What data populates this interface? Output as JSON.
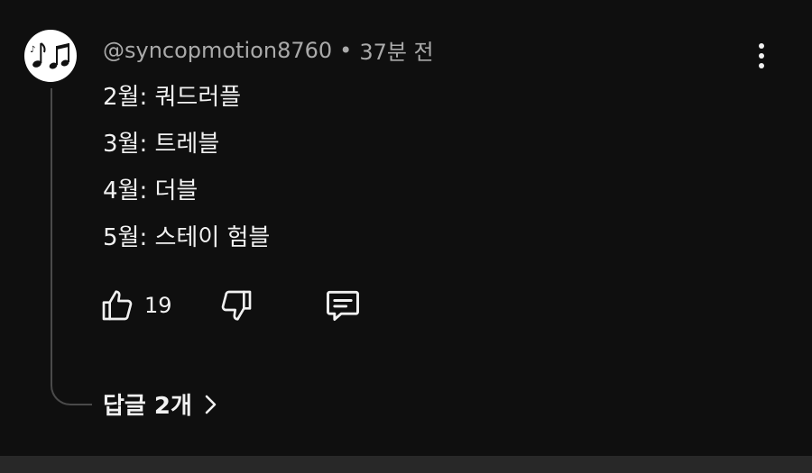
{
  "comment": {
    "author": "@syncopmotion8760",
    "separator": "•",
    "time": "37분 전",
    "lines": [
      "2월: 쿼드러플",
      "3월: 트레블",
      "4월: 더블",
      "5월: 스테이 험블"
    ],
    "likes": "19",
    "replies_label": "답글 2개"
  },
  "icons": {
    "avatar": "music-notes-icon",
    "menu": "more-vert-icon",
    "like": "thumbs-up-icon",
    "dislike": "thumbs-down-icon",
    "reply": "comment-icon",
    "expand": "chevron-right-icon"
  },
  "colors": {
    "background": "#0f0f0f",
    "text": "#f1f1f1",
    "secondary_text": "#aaaaaa",
    "thread_line": "#4a4a4a"
  }
}
